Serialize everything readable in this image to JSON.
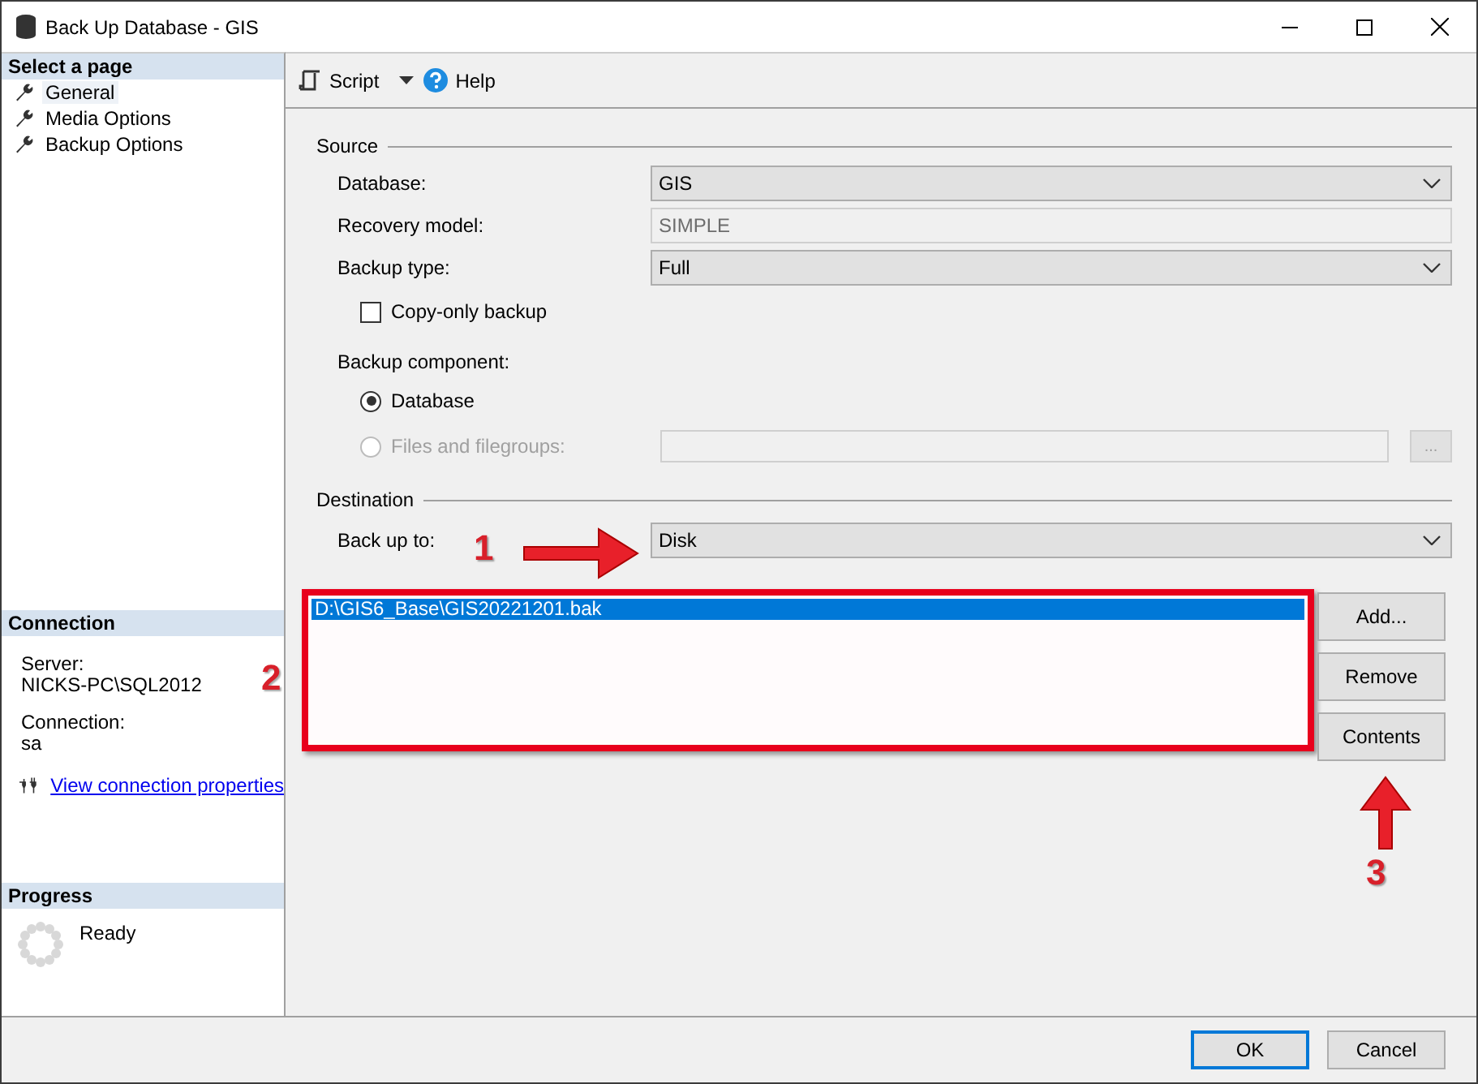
{
  "window": {
    "title": "Back Up Database - GIS"
  },
  "sidebar": {
    "select_page": {
      "heading": "Select a page",
      "items": [
        {
          "label": "General",
          "selected": true
        },
        {
          "label": "Media Options",
          "selected": false
        },
        {
          "label": "Backup Options",
          "selected": false
        }
      ]
    },
    "connection": {
      "heading": "Connection",
      "server_label": "Server:",
      "server": "NICKS-PC\\SQL2012",
      "connection_label": "Connection:",
      "connection": "sa",
      "link": "View connection properties"
    },
    "progress": {
      "heading": "Progress",
      "status": "Ready"
    }
  },
  "toolbar": {
    "script": "Script",
    "help": "Help"
  },
  "source": {
    "heading": "Source",
    "fields": [
      {
        "label": "Database:",
        "value": "GIS",
        "kind": "dropdown"
      },
      {
        "label": "Recovery model:",
        "value": "SIMPLE",
        "kind": "readonly"
      },
      {
        "label": "Backup type:",
        "value": "Full",
        "kind": "dropdown"
      }
    ],
    "copy_only": {
      "label": "Copy-only backup",
      "checked": false
    },
    "component_label": "Backup component:",
    "components": [
      {
        "label": "Database",
        "selected": true,
        "disabled": false
      },
      {
        "label": "Files and filegroups:",
        "selected": false,
        "disabled": true
      }
    ],
    "browse": "..."
  },
  "destination": {
    "heading": "Destination",
    "back_up_to": {
      "label": "Back up to:",
      "value": "Disk"
    },
    "files": [
      {
        "path": "D:\\GIS6_Base\\GIS20221201.bak",
        "selected": true
      }
    ],
    "buttons": [
      "Add...",
      "Remove",
      "Contents"
    ]
  },
  "annotations": [
    {
      "label": "1"
    },
    {
      "label": "2"
    },
    {
      "label": "3"
    }
  ],
  "buttons": [
    {
      "label": "OK",
      "default": true
    },
    {
      "label": "Cancel",
      "default": false
    }
  ]
}
